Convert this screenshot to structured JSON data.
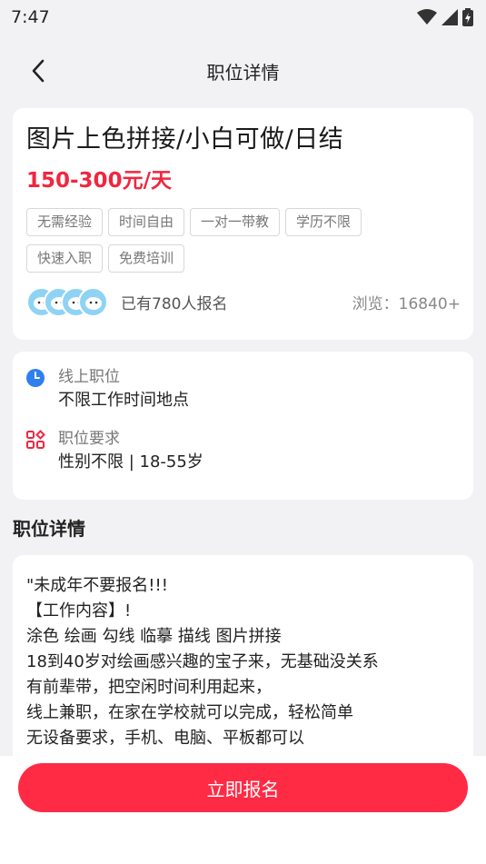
{
  "status_bar": {
    "time": "7:47",
    "icons": [
      "wifi-icon",
      "signal-icon",
      "battery-icon"
    ]
  },
  "nav": {
    "title": "职位详情",
    "back_icon": "chevron-left-icon"
  },
  "job": {
    "title": "图片上色拼接/小白可做/日结",
    "salary": "150-300元/天",
    "tags": [
      "无需经验",
      "时间自由",
      "一对一带教",
      "学历不限",
      "快速入职",
      "免费培训"
    ],
    "signup_count": "已有780人报名",
    "views": "浏览：16840+"
  },
  "info": [
    {
      "icon": "clock-icon",
      "label": "线上职位",
      "value": "不限工作时间地点"
    },
    {
      "icon": "grid-icon",
      "label": "职位要求",
      "value": "性别不限 | 18-55岁"
    }
  ],
  "detail_section_title": "职位详情",
  "detail_lines": [
    "\"未成年不要报名!!!",
    "【工作内容】!",
    "涂色 绘画 勾线 临摹 描线  图片拼接",
    "18到40岁对绘画感兴趣的宝子来，无基础没关系",
    "有前辈带，把空闲时间利用起来，",
    "线上兼职，在家在学校就可以完成，轻松简单",
    "无设备要求，手机、电脑、平板都可以"
  ],
  "action": {
    "signup_label": "立即报名"
  },
  "colors": {
    "accent": "#ff2b45",
    "salary": "#f0273f",
    "info_icon": "#2f80ed",
    "grid_icon": "#f0273f"
  }
}
